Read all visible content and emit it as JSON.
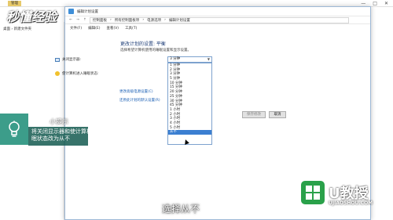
{
  "explorer": {
    "tab_label": "管理",
    "breadcrumb": "桌面 › 新建文件夹",
    "win_buttons": [
      "—",
      "□",
      "✕"
    ]
  },
  "control_panel": {
    "title": "编辑计划设置",
    "breadcrumb": [
      "控制面板",
      "所有控制面板项",
      "电源选项",
      "编辑计划设置"
    ],
    "menu": [
      "文件(F)",
      "编辑(E)",
      "查看(V)",
      "工具(T)"
    ]
  },
  "plan": {
    "heading": "更改计划的设置: 平衡",
    "subheading": "选择希望计算机使用的睡眠设置和显示设置。",
    "display_off_label": "关闭显示器:",
    "sleep_label": "使计算机进入睡眠状态:",
    "display_off_value": "3 分钟",
    "options": [
      "1 分钟",
      "2 分钟",
      "3 分钟",
      "5 分钟",
      "10 分钟",
      "15 分钟",
      "20 分钟",
      "25 分钟",
      "30 分钟",
      "45 分钟",
      "1 小时",
      "2 小时",
      "3 小时",
      "4 小时",
      "5 小时",
      "从不"
    ],
    "selected_index": 15,
    "link_advanced": "更改高级电源设置(C)",
    "link_restore": "还原此计划的默认设置(R)",
    "save_button": "保存修改",
    "cancel_button": "取消"
  },
  "tip": {
    "title": "小提示",
    "text": "将关闭显示器和使计算机进入睡眠状态改为从不"
  },
  "subtitle": "选择从不",
  "watermark": {
    "top": "秒懂经验",
    "brand": "U教授",
    "url": "UJIAOSHOU.COM"
  }
}
